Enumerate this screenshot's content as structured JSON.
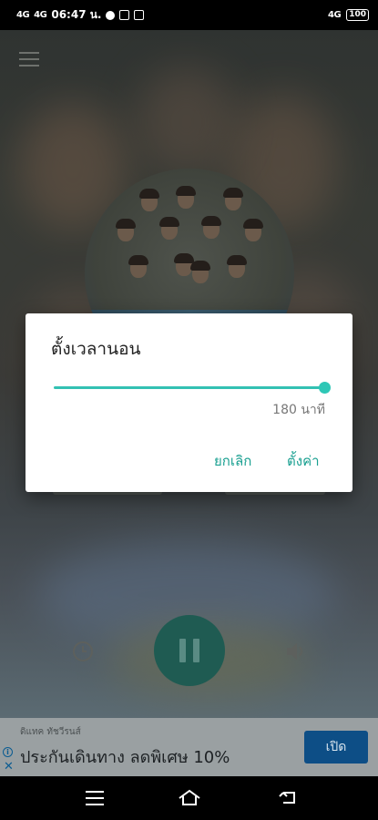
{
  "status_bar": {
    "carrier1": "4G",
    "carrier2": "4G",
    "time": "06:47 น.",
    "battery": "100"
  },
  "background": {
    "menu_icon": "hamburger-icon"
  },
  "controls": {
    "alarm_icon": "alarm-clock-icon",
    "play_icon": "pause-icon",
    "volume_icon": "speaker-icon",
    "accent": "#1f5b52"
  },
  "dialog": {
    "title": "ตั้งเวลานอน",
    "slider_value_fraction": 1.0,
    "value_label": "180 นาที",
    "cancel_label": "ยกเลิก",
    "set_label": "ตั้งค่า",
    "accent": "#2ec7b6"
  },
  "ad": {
    "advertiser": "ดิแทค ทัชวีรนส์",
    "headline": "ประกันเดินทาง ลดพิเศษ 10%",
    "cta": "เปิด",
    "cta_color": "#0d4e86"
  },
  "nav": {
    "menu_icon": "recent-apps-icon",
    "home_icon": "home-icon",
    "back_icon": "back-icon"
  }
}
